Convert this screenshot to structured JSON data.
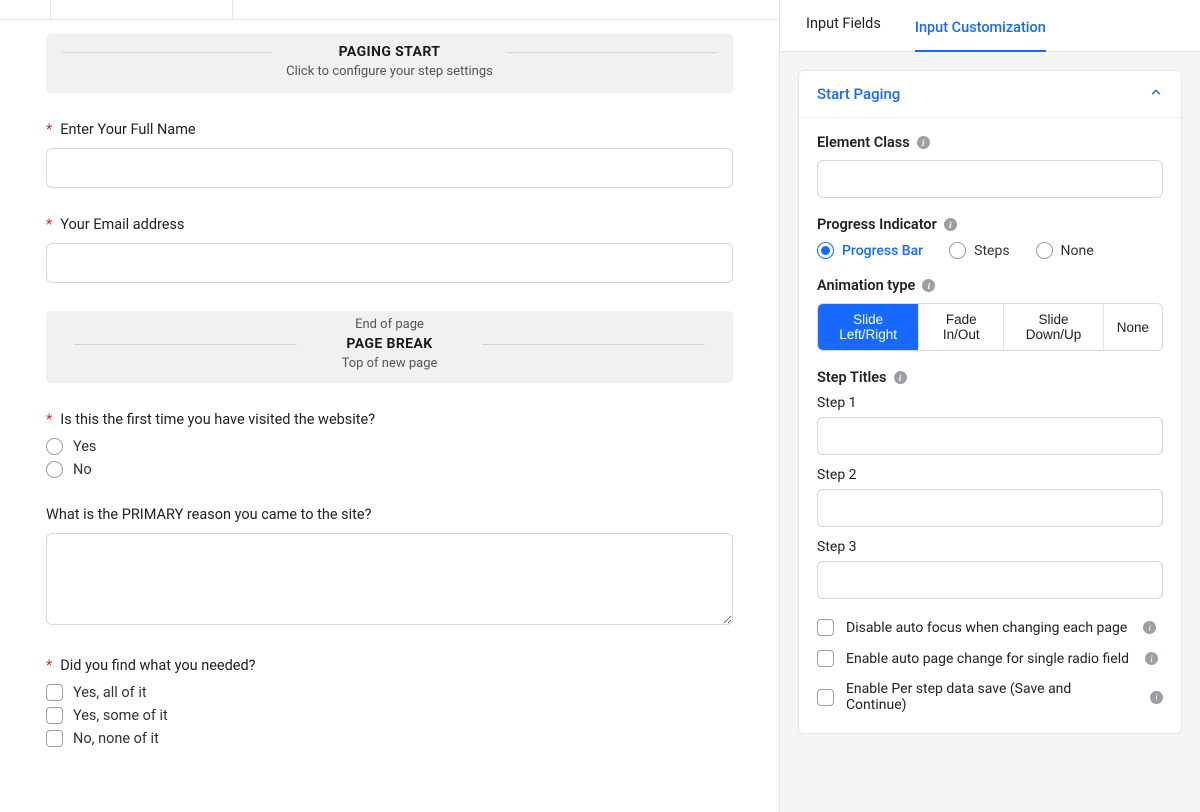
{
  "form": {
    "pagingStart": {
      "title": "PAGING START",
      "subtitle": "Click to configure your step settings"
    },
    "fields": {
      "name": {
        "label": "Enter Your Full Name",
        "required": true
      },
      "email": {
        "label": "Your Email address",
        "required": true
      },
      "firstVisit": {
        "label": "Is this the first time you have visited the website?",
        "required": true,
        "options": [
          "Yes",
          "No"
        ]
      },
      "reason": {
        "label": "What is the PRIMARY reason you came to the site?",
        "required": false
      },
      "found": {
        "label": "Did you find what you needed?",
        "required": true,
        "options": [
          "Yes, all of it",
          "Yes, some of it",
          "No, none of it"
        ]
      }
    },
    "pageBreak": {
      "top": "End of page",
      "title": "PAGE BREAK",
      "bottom": "Top of new page"
    }
  },
  "sidebar": {
    "tabs": {
      "inputFields": "Input Fields",
      "inputCustomization": "Input Customization"
    },
    "panel": {
      "title": "Start Paging",
      "elementClass": {
        "label": "Element Class"
      },
      "progressIndicator": {
        "label": "Progress Indicator",
        "options": {
          "bar": "Progress Bar",
          "steps": "Steps",
          "none": "None"
        },
        "selected": "bar"
      },
      "animationType": {
        "label": "Animation type",
        "options": [
          "Slide Left/Right",
          "Fade In/Out",
          "Slide Down/Up",
          "None"
        ],
        "selectedIndex": 0
      },
      "stepTitles": {
        "label": "Step Titles",
        "steps": [
          "Step 1",
          "Step 2",
          "Step 3"
        ]
      },
      "checks": {
        "disableAutoFocus": "Disable auto focus when changing each page",
        "autoPageChange": "Enable auto page change for single radio field",
        "perStepSave": "Enable Per step data save (Save and Continue)"
      }
    }
  }
}
